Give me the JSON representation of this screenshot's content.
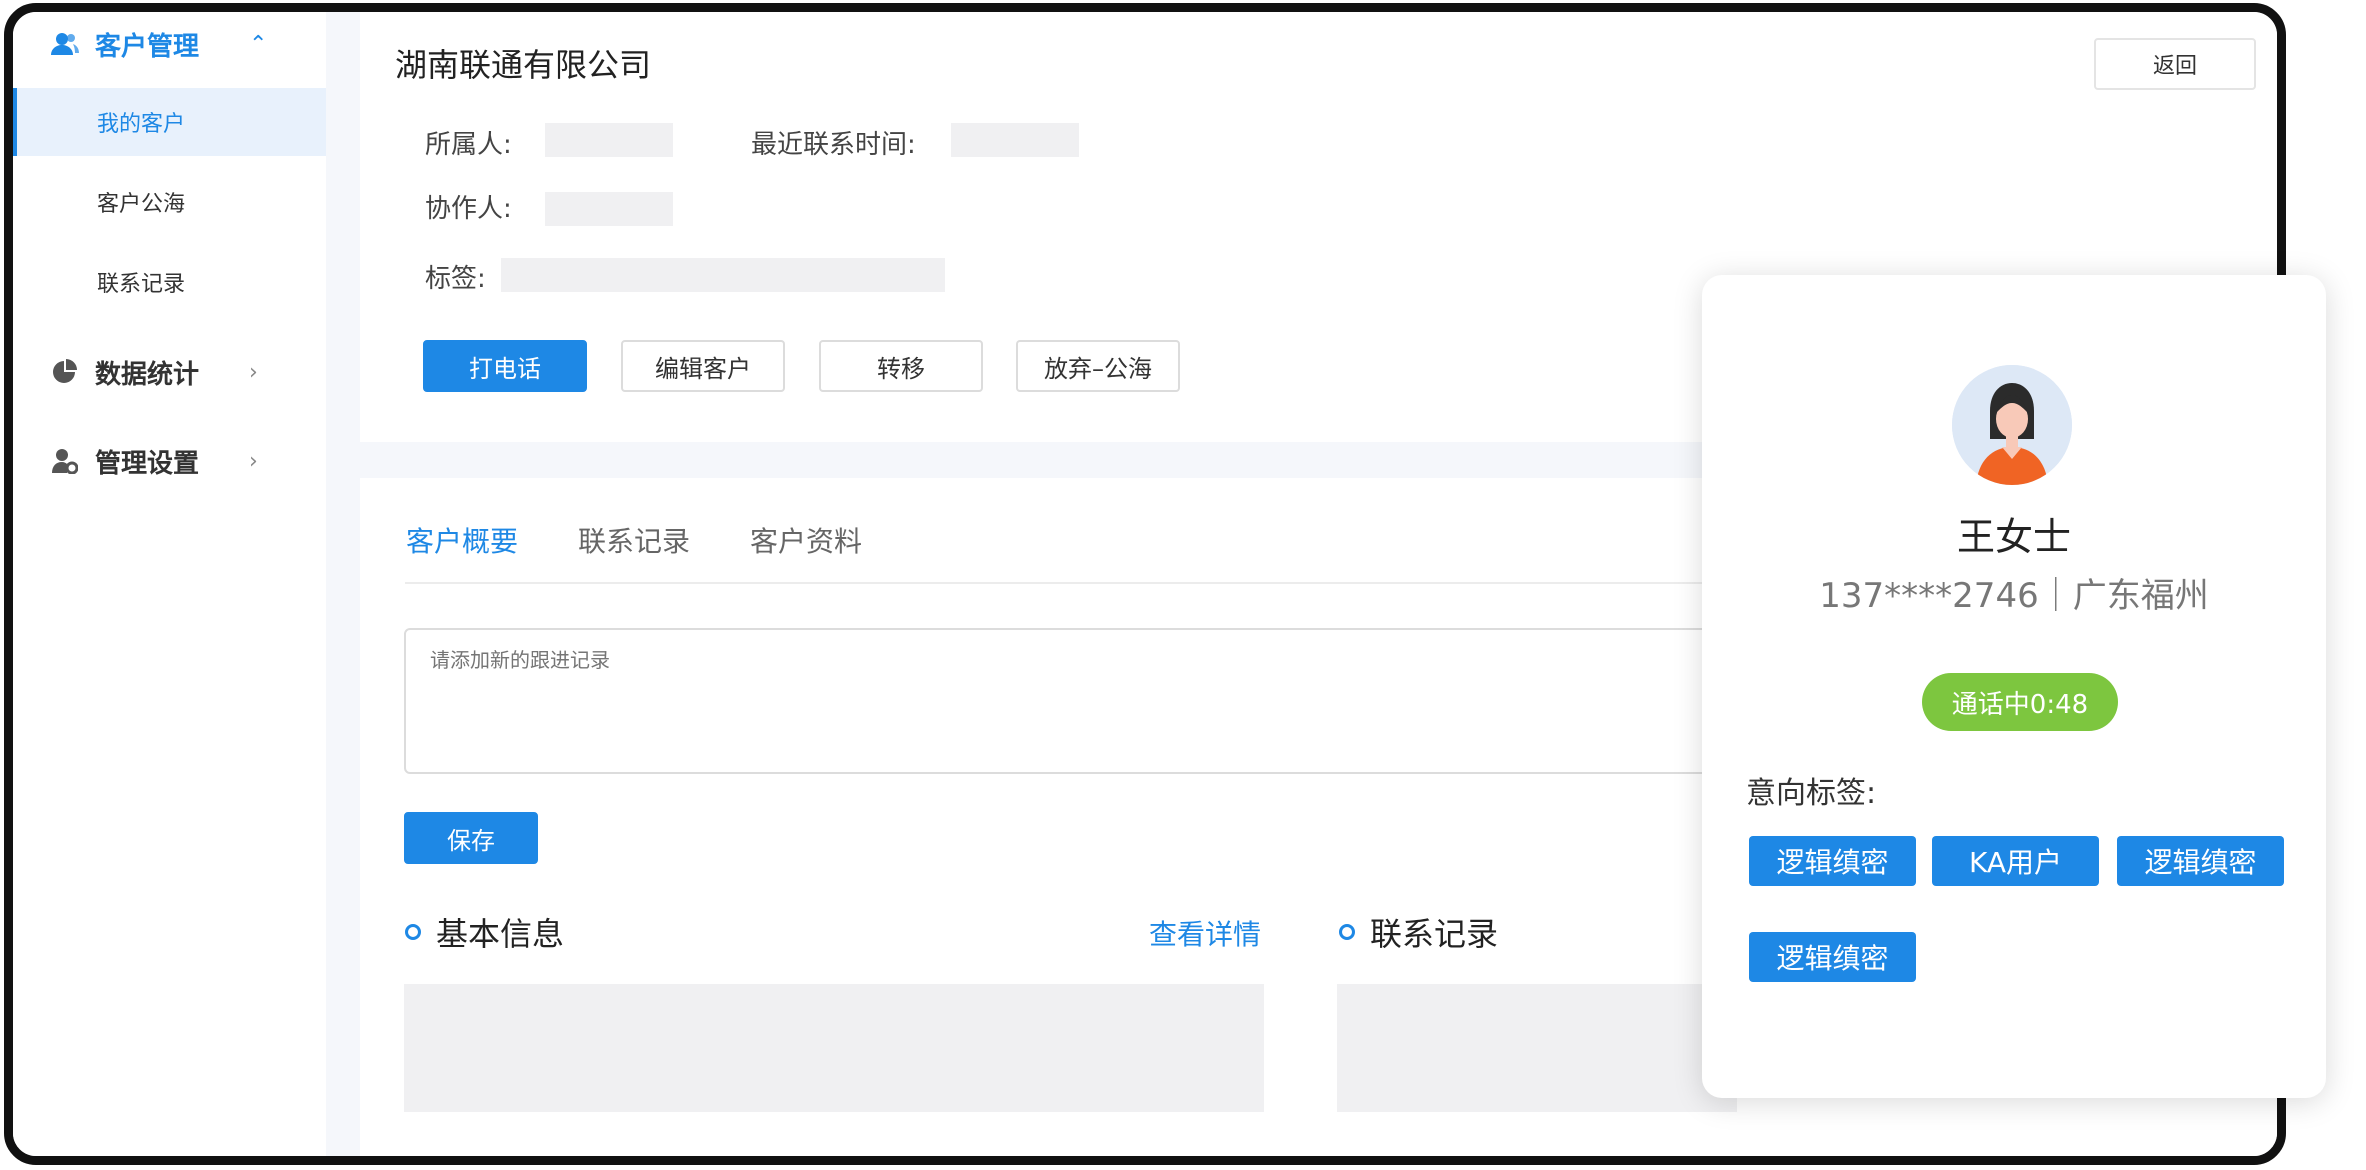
{
  "sidebar": {
    "groups": [
      {
        "label": "客户管理",
        "icon": "users-icon"
      },
      {
        "label": "数据统计",
        "icon": "pie-chart-icon"
      },
      {
        "label": "管理设置",
        "icon": "user-settings-icon"
      }
    ],
    "items": [
      {
        "label": "我的客户",
        "active": true
      },
      {
        "label": "客户公海"
      },
      {
        "label": "联系记录"
      }
    ]
  },
  "header": {
    "company": "湖南联通有限公司",
    "back_label": "返回"
  },
  "fields": {
    "owner_label": "所属人:",
    "last_contact_label": "最近联系时间:",
    "collaborator_label": "协作人:",
    "tags_label": "标签:"
  },
  "actions": {
    "call": "打电话",
    "edit": "编辑客户",
    "transfer": "转移",
    "abandon": "放弃–公海"
  },
  "tabs": [
    "客户概要",
    "联系记录",
    "客户资料"
  ],
  "followup": {
    "placeholder": "请添加新的跟进记录",
    "save_label": "保存"
  },
  "sections": {
    "basic_info": "基本信息",
    "view_details": "查看详情",
    "contact_records": "联系记录"
  },
  "call_card": {
    "name": "王女士",
    "info": "137****2746｜广东福州",
    "status": "通话中0:48",
    "intent_label": "意向标签:",
    "tags": [
      "逻辑缜密",
      "KA用户",
      "逻辑缜密",
      "逻辑缜密"
    ]
  },
  "colors": {
    "accent": "#1e88e5",
    "call_status": "#7dc63f",
    "active_bg": "#e8f1fc"
  }
}
